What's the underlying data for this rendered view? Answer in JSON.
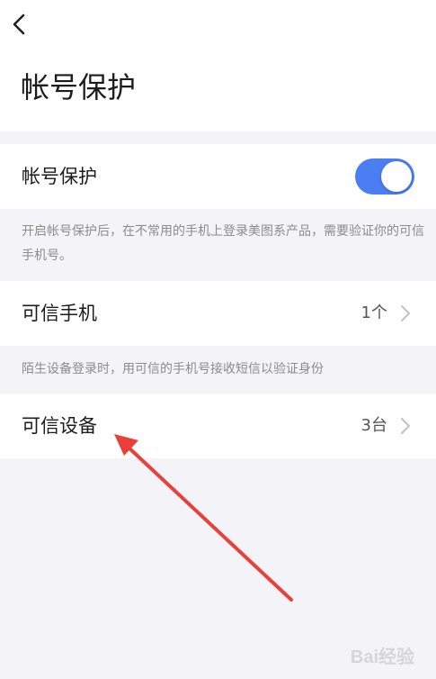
{
  "header": {
    "back_icon": "chevron-left-icon",
    "title": "帐号保护"
  },
  "protection": {
    "label": "帐号保护",
    "toggle_on": true,
    "toggle_color": "#4a7ef2",
    "hint": "开启帐号保护后，在不常用的手机上登录美图系产品，需要验证你的可信手机号。"
  },
  "trusted_phone": {
    "label": "可信手机",
    "value": "1个",
    "chevron_icon": "chevron-right-icon",
    "hint": "陌生设备登录时，用可信的手机号接收短信以验证身份"
  },
  "trusted_device": {
    "label": "可信设备",
    "value": "3台",
    "chevron_icon": "chevron-right-icon"
  },
  "annotation": {
    "arrow_color": "#e8403a"
  },
  "watermark": {
    "text": "Bai经验"
  }
}
